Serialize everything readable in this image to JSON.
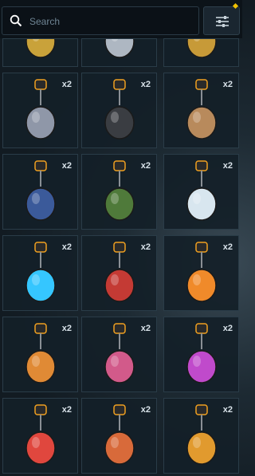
{
  "search": {
    "placeholder": "Search"
  },
  "rows": [
    {
      "partial": true,
      "items": [
        {
          "name": "partial-charm-yellow-robot",
          "qty": "",
          "color": "#c9a23a"
        },
        {
          "name": "partial-charm-silver-orb",
          "qty": "",
          "color": "#aeb7c2"
        },
        {
          "name": "partial-charm-gold-emblem",
          "qty": "",
          "color": "#c79a38"
        }
      ]
    },
    {
      "items": [
        {
          "name": "charm-skateboard",
          "qty": "x2",
          "color": "#8f97a8"
        },
        {
          "name": "charm-calculator",
          "qty": "x2",
          "color": "#3a3d42"
        },
        {
          "name": "charm-coffee-cup",
          "qty": "x2",
          "color": "#b88a5c"
        }
      ]
    },
    {
      "items": [
        {
          "name": "charm-mech-bird",
          "qty": "x2",
          "color": "#3b5a9a"
        },
        {
          "name": "charm-green-creature",
          "qty": "x2",
          "color": "#4f7a3a"
        },
        {
          "name": "charm-crystal-prism",
          "qty": "x2",
          "color": "#d8e6ef"
        }
      ]
    },
    {
      "items": [
        {
          "name": "charm-neon-spike-cube",
          "qty": "x2",
          "color": "#35c6ff"
        },
        {
          "name": "charm-red-robot",
          "qty": "x2",
          "color": "#c43a34"
        },
        {
          "name": "charm-orange-orb-globe",
          "qty": "x2",
          "color": "#f08a2a"
        }
      ]
    },
    {
      "items": [
        {
          "name": "charm-orange-robot",
          "qty": "x2",
          "color": "#e08a35"
        },
        {
          "name": "charm-ep-5-medal",
          "qty": "x2",
          "color": "#d25a8a"
        },
        {
          "name": "charm-ep-4-medal",
          "qty": "x2",
          "color": "#c04acb"
        }
      ]
    },
    {
      "items": [
        {
          "name": "charm-ep-6-medal",
          "qty": "x2",
          "color": "#e0473e"
        },
        {
          "name": "charm-ep-5-copper-medal",
          "qty": "x2",
          "color": "#d86a3a"
        },
        {
          "name": "charm-ep-4-gold-medal",
          "qty": "x2",
          "color": "#e19a2e"
        }
      ]
    }
  ]
}
